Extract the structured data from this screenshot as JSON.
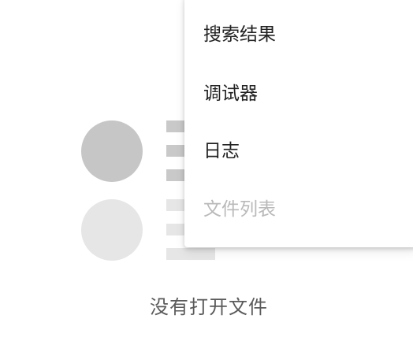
{
  "menu": {
    "items": [
      {
        "label": "搜索结果",
        "enabled": true
      },
      {
        "label": "调试器",
        "enabled": true
      },
      {
        "label": "日志",
        "enabled": true
      },
      {
        "label": "文件列表",
        "enabled": false
      }
    ]
  },
  "empty_state": {
    "message": "没有打开文件"
  },
  "colors": {
    "text_primary": "#222222",
    "text_disabled": "#b9b9b9",
    "text_secondary": "#5a5a5a",
    "placeholder_dark": "#c6c6c6",
    "placeholder_light": "#e6e6e6"
  }
}
